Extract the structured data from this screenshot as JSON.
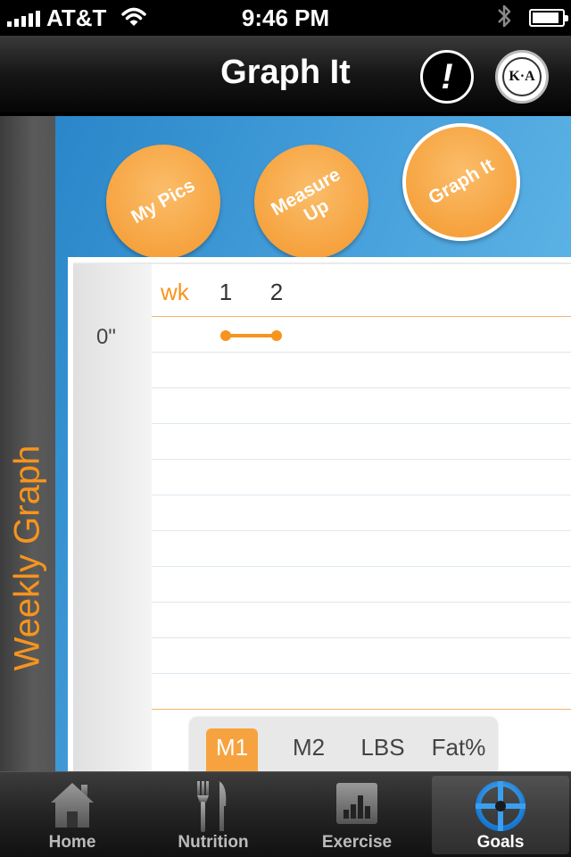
{
  "status_bar": {
    "carrier": "AT&T",
    "time": "9:46 PM",
    "bluetooth_icon": "bluetooth-icon",
    "battery_level": 0.9
  },
  "nav": {
    "title": "Graph It",
    "alert_symbol": "!",
    "logo_text": "K·A"
  },
  "sidebar": {
    "label": "Weekly Graph"
  },
  "buttons": [
    {
      "label": "My Pics",
      "active": false
    },
    {
      "label": "Measure Up",
      "active": false
    },
    {
      "label": "Graph It",
      "active": true
    }
  ],
  "chart_data": {
    "type": "line",
    "xlabel": "wk",
    "ylabel": "",
    "x": [
      1,
      2
    ],
    "y_tick_label": "0\"",
    "series": [
      {
        "values": [
          0,
          0
        ],
        "color": "#f7941d"
      }
    ],
    "grid": true
  },
  "segmented": {
    "options": [
      "M1",
      "M2",
      "LBS",
      "Fat%"
    ],
    "selected": "M1"
  },
  "tabs": [
    {
      "label": "Home",
      "icon": "home-icon",
      "active": false
    },
    {
      "label": "Nutrition",
      "icon": "fork-knife-icon",
      "active": false
    },
    {
      "label": "Exercise",
      "icon": "bar-chart-icon",
      "active": false
    },
    {
      "label": "Goals",
      "icon": "crosshair-icon",
      "active": true
    }
  ],
  "colors": {
    "accent": "#f7941d",
    "button_orange": "#f6a33f",
    "blue": "#4aa3dd"
  }
}
